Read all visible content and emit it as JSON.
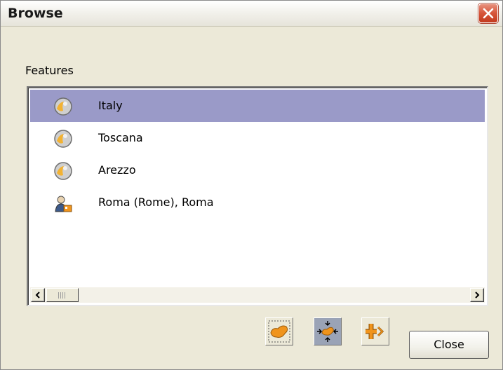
{
  "window": {
    "title": "Browse",
    "close_icon": "close-x-icon",
    "close_color": "#d6553a"
  },
  "features": {
    "label": "Features",
    "items": [
      {
        "label": "Italy",
        "icon": "region-globe-icon",
        "selected": true
      },
      {
        "label": "Toscana",
        "icon": "region-globe-icon",
        "selected": false
      },
      {
        "label": "Arezzo",
        "icon": "region-globe-icon",
        "selected": false
      },
      {
        "label": "Roma (Rome), Roma",
        "icon": "populated-place-icon",
        "selected": false
      }
    ],
    "selection_color": "#9a9ac8"
  },
  "toolbar": {
    "buttons": [
      {
        "name": "select-feature-button",
        "icon": "feature-shape-icon"
      },
      {
        "name": "zoom-to-feature-button",
        "icon": "zoom-to-feature-icon"
      },
      {
        "name": "add-to-map-button",
        "icon": "add-arrow-icon"
      }
    ],
    "close_label": "Close",
    "accent": "#f0941c"
  }
}
